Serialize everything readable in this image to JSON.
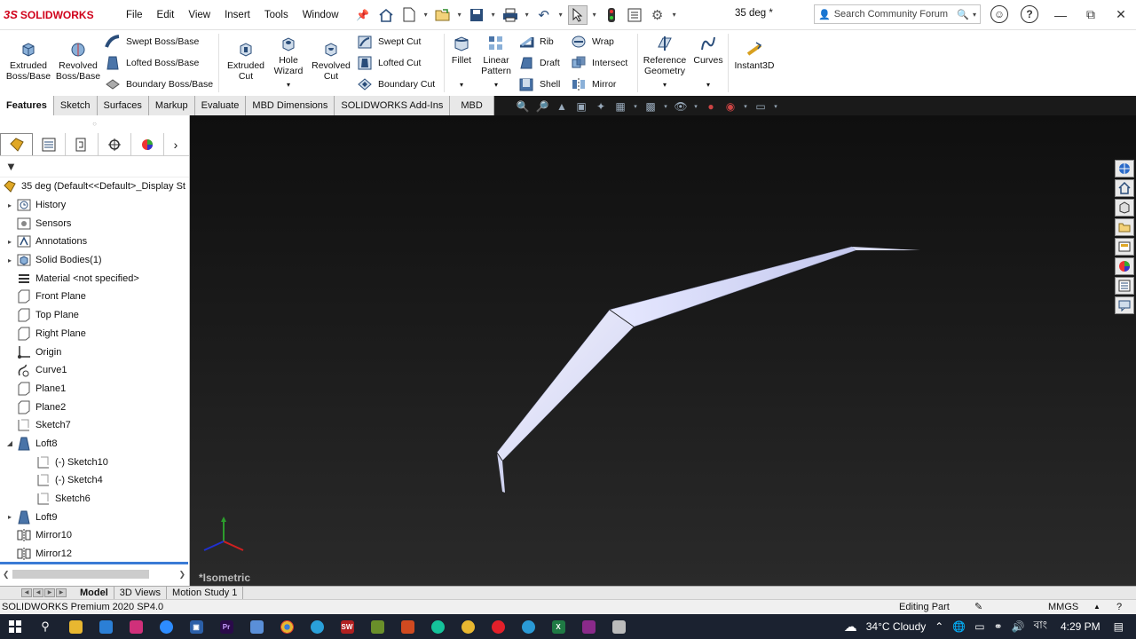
{
  "app": {
    "brand": "SOLIDWORKS",
    "brand_prefix": "3S",
    "doc_title": "35 deg *"
  },
  "menu": [
    "File",
    "Edit",
    "View",
    "Insert",
    "Tools",
    "Window"
  ],
  "search": {
    "placeholder": "Search Community Forum"
  },
  "ribbon": {
    "extruded_boss": "Extruded Boss/Base",
    "revolved_boss": "Revolved Boss/Base",
    "swept_boss": "Swept Boss/Base",
    "lofted_boss": "Lofted Boss/Base",
    "boundary_boss": "Boundary Boss/Base",
    "extruded_cut": "Extruded Cut",
    "hole_wizard": "Hole Wizard",
    "revolved_cut": "Revolved Cut",
    "swept_cut": "Swept Cut",
    "lofted_cut": "Lofted Cut",
    "boundary_cut": "Boundary Cut",
    "fillet": "Fillet",
    "linear_pattern": "Linear Pattern",
    "rib": "Rib",
    "draft": "Draft",
    "shell": "Shell",
    "wrap": "Wrap",
    "intersect": "Intersect",
    "mirror": "Mirror",
    "reference_geometry": "Reference Geometry",
    "curves": "Curves",
    "instant3d": "Instant3D"
  },
  "command_tabs": [
    "Features",
    "Sketch",
    "Surfaces",
    "Markup",
    "Evaluate",
    "MBD Dimensions",
    "SOLIDWORKS Add-Ins",
    "MBD"
  ],
  "tree": {
    "root": "35 deg  (Default<<Default>_Display St",
    "items": [
      {
        "label": "History",
        "icon": "history-icon",
        "expand": true,
        "indent": 0
      },
      {
        "label": "Sensors",
        "icon": "sensor-icon",
        "expand": false,
        "indent": 0
      },
      {
        "label": "Annotations",
        "icon": "annotation-icon",
        "expand": true,
        "indent": 0
      },
      {
        "label": "Solid Bodies(1)",
        "icon": "solid-body-icon",
        "expand": true,
        "indent": 0
      },
      {
        "label": "Material <not specified>",
        "icon": "material-icon",
        "expand": false,
        "indent": 0
      },
      {
        "label": "Front Plane",
        "icon": "plane-icon",
        "expand": false,
        "indent": 0
      },
      {
        "label": "Top Plane",
        "icon": "plane-icon",
        "expand": false,
        "indent": 0
      },
      {
        "label": "Right Plane",
        "icon": "plane-icon",
        "expand": false,
        "indent": 0
      },
      {
        "label": "Origin",
        "icon": "origin-icon",
        "expand": false,
        "indent": 0
      },
      {
        "label": "Curve1",
        "icon": "curve-icon",
        "expand": false,
        "indent": 0
      },
      {
        "label": "Plane1",
        "icon": "plane-icon",
        "expand": false,
        "indent": 0
      },
      {
        "label": "Plane2",
        "icon": "plane-icon",
        "expand": false,
        "indent": 0
      },
      {
        "label": "Sketch7",
        "icon": "sketch-icon",
        "expand": false,
        "indent": 0
      },
      {
        "label": "Loft8",
        "icon": "loft-icon",
        "expand": "open",
        "indent": 0
      },
      {
        "label": "(-) Sketch10",
        "icon": "sketch-icon",
        "expand": false,
        "indent": 1
      },
      {
        "label": "(-) Sketch4",
        "icon": "sketch-icon",
        "expand": false,
        "indent": 1
      },
      {
        "label": "Sketch6",
        "icon": "sketch-icon",
        "expand": false,
        "indent": 1
      },
      {
        "label": "Loft9",
        "icon": "loft-icon",
        "expand": true,
        "indent": 0
      },
      {
        "label": "Mirror10",
        "icon": "mirror-icon",
        "expand": false,
        "indent": 0
      },
      {
        "label": "Mirror12",
        "icon": "mirror-icon",
        "expand": false,
        "indent": 0
      }
    ]
  },
  "viewport": {
    "view_name": "*Isometric"
  },
  "bottom_tabs": [
    "Model",
    "3D Views",
    "Motion Study 1"
  ],
  "status": {
    "product": "SOLIDWORKS Premium 2020 SP4.0",
    "mode": "Editing Part",
    "units": "MMGS"
  },
  "taskbar": {
    "weather": "34°C  Cloudy",
    "language": "বাং",
    "time": "4:29 PM"
  }
}
